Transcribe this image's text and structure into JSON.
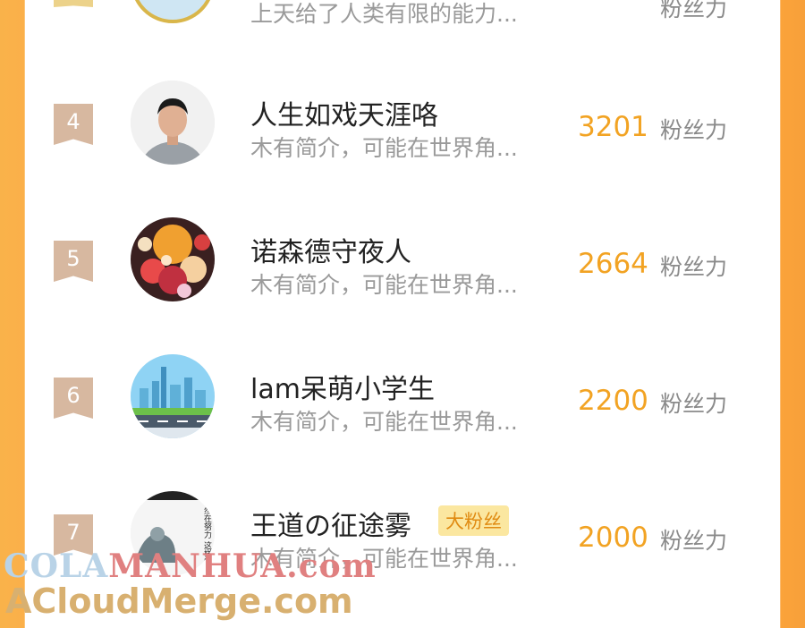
{
  "colors": {
    "accent": "#f2a323",
    "rank_badge": "#d7b8a0",
    "side_orange": "#fba33a",
    "fan_badge_bg": "#fbe7a0"
  },
  "top_partial": {
    "desc": "上天给了人类有限的能力...",
    "unit": "粉丝力"
  },
  "list": [
    {
      "rank": "4",
      "name": "人生如戏天涯咯",
      "desc": "木有简介，可能在世界角...",
      "score": "3201",
      "unit": "粉丝力",
      "avatar_icon": "person-photo-avatar"
    },
    {
      "rank": "5",
      "name": "诺森德守夜人",
      "desc": "木有简介，可能在世界角...",
      "score": "2664",
      "unit": "粉丝力",
      "avatar_icon": "anime-art-avatar"
    },
    {
      "rank": "6",
      "name": "lam呆萌小学生",
      "desc": "木有简介，可能在世界角...",
      "score": "2200",
      "unit": "粉丝力",
      "avatar_icon": "city-skyline-avatar"
    },
    {
      "rank": "7",
      "name": "王道の征途雾",
      "badge": "大粉丝",
      "desc": "木有简介，可能在世界角...",
      "score": "2000",
      "unit": "粉丝力",
      "avatar_icon": "meme-avatar",
      "avatar_text": "依然在努力 这样的我"
    }
  ],
  "watermark": {
    "line1_a": "COLA",
    "line1_b": "MANHUA.com",
    "line2": "ACloudMerge.com"
  }
}
